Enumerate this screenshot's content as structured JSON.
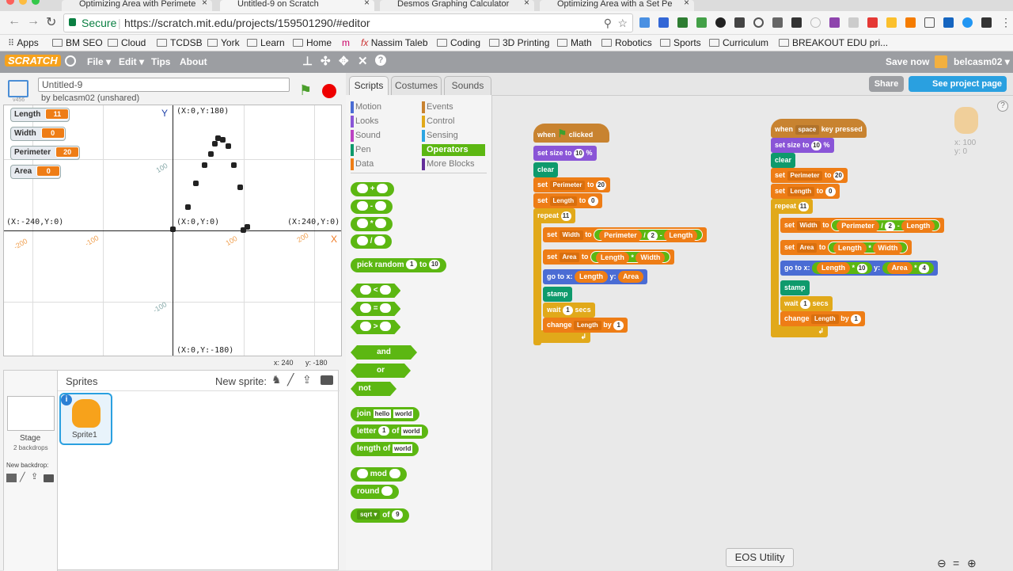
{
  "browser": {
    "tabs": [
      {
        "title": "Optimizing Area with Perimete"
      },
      {
        "title": "Untitled-9 on Scratch"
      },
      {
        "title": "Desmos Graphing Calculator"
      },
      {
        "title": "Optimizing Area with a Set Pe"
      }
    ],
    "secure_label": "Secure",
    "url": "https://scratch.mit.edu/projects/159501290/#editor",
    "bookmarks": [
      "Apps",
      "BM SEO",
      "Cloud",
      "TCDSB",
      "York",
      "Learn",
      "Home",
      "Nassim Taleb",
      "Coding",
      "3D Printing",
      "Math",
      "Robotics",
      "Sports",
      "Curriculum",
      "BREAKOUT EDU pri..."
    ]
  },
  "scratch": {
    "logo": "SCRATCH",
    "menu": [
      "File ▾",
      "Edit ▾",
      "Tips",
      "About"
    ],
    "save_now": "Save now",
    "username": "belcasm02 ▾",
    "share": "Share",
    "see_project": "See project page"
  },
  "project": {
    "title": "Untitled-9",
    "byline": "by belcasm02 (unshared)",
    "version": "v456"
  },
  "monitors": [
    {
      "label": "Length",
      "value": "11"
    },
    {
      "label": "Width",
      "value": "0"
    },
    {
      "label": "Perimeter",
      "value": "20"
    },
    {
      "label": "Area",
      "value": "0"
    }
  ],
  "stage": {
    "labels": {
      "top": "(X:0,Y:180)",
      "left": "(X:-240,Y:0)",
      "center": "(X:0,Y:0)",
      "right": "(X:240,Y:0)",
      "bottom": "(X:0,Y:-180)",
      "yaxis": "Y",
      "xaxis": "X"
    },
    "ticks_x": [
      "-200",
      "-100",
      "100",
      "200"
    ],
    "ticks_y": [
      "100",
      "-100"
    ],
    "readout_x": "x: 240",
    "readout_y": "y: -180"
  },
  "editor_tabs": [
    "Scripts",
    "Costumes",
    "Sounds"
  ],
  "categories_left": [
    {
      "label": "Motion",
      "color": "#4a6cd4"
    },
    {
      "label": "Looks",
      "color": "#8a55d7"
    },
    {
      "label": "Sound",
      "color": "#bb42c3"
    },
    {
      "label": "Pen",
      "color": "#0e9a6c"
    },
    {
      "label": "Data",
      "color": "#ee7d16"
    }
  ],
  "categories_right": [
    {
      "label": "Events",
      "color": "#c88330"
    },
    {
      "label": "Control",
      "color": "#e1a91a"
    },
    {
      "label": "Sensing",
      "color": "#2ca5e2"
    },
    {
      "label": "Operators",
      "color": "#5cb712"
    },
    {
      "label": "More Blocks",
      "color": "#632d99"
    }
  ],
  "palette_blocks": {
    "add": "+",
    "sub": "-",
    "mul": "*",
    "div": "/",
    "pick_random": "pick random",
    "pick_to": "to",
    "pick_a": "1",
    "pick_b": "10",
    "lt": "<",
    "eq": "=",
    "gt": ">",
    "and": "and",
    "or": "or",
    "not": "not",
    "join": "join",
    "join_a": "hello",
    "join_b": "world",
    "letter": "letter",
    "letter_n": "1",
    "of": "of",
    "letter_s": "world",
    "length_of": "length of",
    "length_s": "world",
    "mod": "mod",
    "round": "round",
    "sqrt": "sqrt ▾",
    "sqrt_of": "of",
    "sqrt_n": "9"
  },
  "script1": {
    "when": "when",
    "clicked": "clicked",
    "set_size": "set size to",
    "size_val": "10",
    "pct": "%",
    "clear": "clear",
    "set": "set",
    "to": "to",
    "perimeter": "Perimeter",
    "length": "Length",
    "width": "Width",
    "area": "Area",
    "per_val": "20",
    "len_val": "0",
    "repeat": "repeat",
    "repeat_val": "11",
    "div": "/",
    "two": "2",
    "minus": "-",
    "times": "*",
    "goto": "go to x:",
    "y": "y:",
    "stamp": "stamp",
    "wait": "wait",
    "wait_val": "1",
    "secs": "secs",
    "change": "change",
    "by": "by",
    "by_val": "1"
  },
  "script2": {
    "when": "when",
    "key": "space",
    "key_pressed": "key pressed",
    "set_size": "set size to",
    "size_val": "10",
    "pct": "%",
    "clear": "clear",
    "set": "set",
    "to": "to",
    "perimeter": "Perimeter",
    "length": "Length",
    "width": "Width",
    "area": "Area",
    "per_val": "20",
    "len_val": "0",
    "repeat": "repeat",
    "repeat_val": "11",
    "div": "/",
    "two": "2",
    "minus": "-",
    "times": "*",
    "goto": "go to x:",
    "y": "y:",
    "ten": "10",
    "four": "4",
    "stamp": "stamp",
    "wait": "wait",
    "wait_val": "1",
    "secs": "secs",
    "change": "change",
    "by": "by",
    "by_val": "1"
  },
  "sprite_info": {
    "x": "x: 100",
    "y": "y: 0"
  },
  "sprites": {
    "header": "Sprites",
    "new_sprite": "New sprite:",
    "stage_label": "Stage",
    "backdrops": "2 backdrops",
    "new_backdrop": "New backdrop:",
    "sprite1": "Sprite1"
  },
  "tooltip": "EOS Utility"
}
